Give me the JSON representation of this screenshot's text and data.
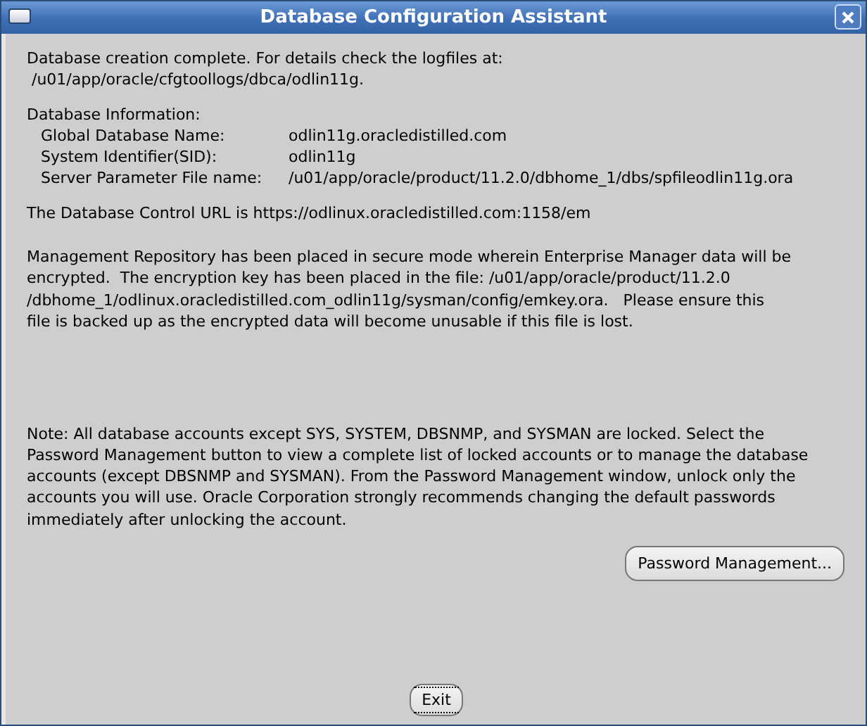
{
  "window": {
    "title": "Database Configuration Assistant"
  },
  "completion_message": [
    "Database creation complete. For details check the logfiles at:",
    " /u01/app/oracle/cfgtoollogs/dbca/odlin11g."
  ],
  "database_information": {
    "heading": "Database Information:",
    "rows": [
      {
        "label": "Global Database Name:",
        "value": "odlin11g.oracledistilled.com"
      },
      {
        "label": "System Identifier(SID):",
        "value": "odlin11g"
      },
      {
        "label": "Server Parameter File name:",
        "value": "/u01/app/oracle/product/11.2.0/dbhome_1/dbs/spfileodlin11g.ora"
      }
    ]
  },
  "control_url_text": "The Database Control URL is https://odlinux.oracledistilled.com:1158/em",
  "repository_message": [
    "Management Repository has been placed in secure mode wherein Enterprise Manager data will be",
    "encrypted.  The encryption key has been placed in the file: /u01/app/oracle/product/11.2.0",
    "/dbhome_1/odlinux.oracledistilled.com_odlin11g/sysman/config/emkey.ora.   Please ensure this",
    "file is backed up as the encrypted data will become unusable if this file is lost."
  ],
  "note": [
    "Note: All database accounts except SYS, SYSTEM, DBSNMP, and SYSMAN are locked. Select the",
    "Password Management button to view a complete list of locked accounts or to manage the database",
    "accounts (except DBSNMP and SYSMAN). From the Password Management window, unlock only the",
    "accounts you will use. Oracle Corporation strongly recommends changing the default passwords",
    "immediately after unlocking the account."
  ],
  "password_management_button": {
    "label": "Password Management...",
    "focused": false
  },
  "exit_button": {
    "label": "Exit",
    "focused": true
  }
}
